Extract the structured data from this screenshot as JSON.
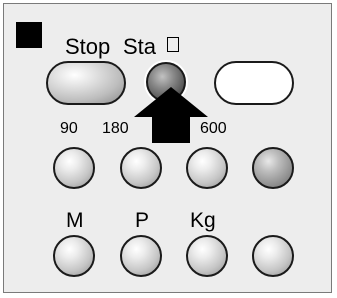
{
  "controls": {
    "stop_label": "Stop",
    "start_label": "Sta",
    "cursor_glyph": "ꞁ"
  },
  "row2_labels": [
    "90",
    "180",
    "",
    "600"
  ],
  "row3_labels": [
    "M",
    "P",
    "Kg"
  ],
  "icons": {
    "corner": "black-square",
    "pointer": "up-arrow"
  },
  "colors": {
    "panel_bg": "#ededed",
    "border": "#7a7a7a",
    "arrow": "#000000"
  }
}
